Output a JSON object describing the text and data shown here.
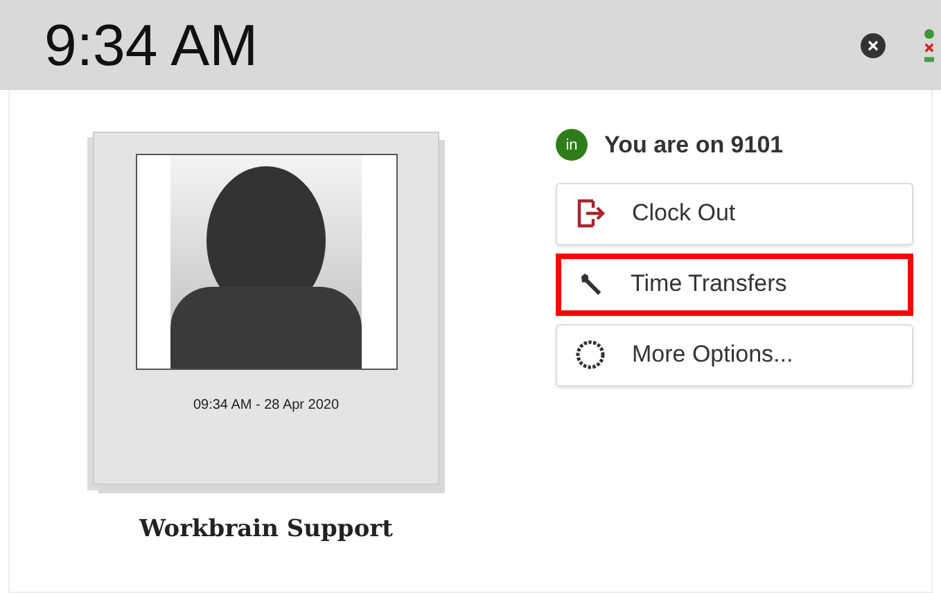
{
  "header": {
    "time": "9:34 AM"
  },
  "photo": {
    "caption": "09:34 AM - 28 Apr 2020"
  },
  "employee": {
    "name": "Workbrain Support"
  },
  "status": {
    "badge": "in",
    "text": "You are on 9101"
  },
  "options": [
    {
      "label": "Clock Out",
      "kind": "clock-out",
      "highlighted": false
    },
    {
      "label": "Time Transfers",
      "kind": "wrench",
      "highlighted": true
    },
    {
      "label": "More Options...",
      "kind": "gear",
      "highlighted": false
    }
  ]
}
